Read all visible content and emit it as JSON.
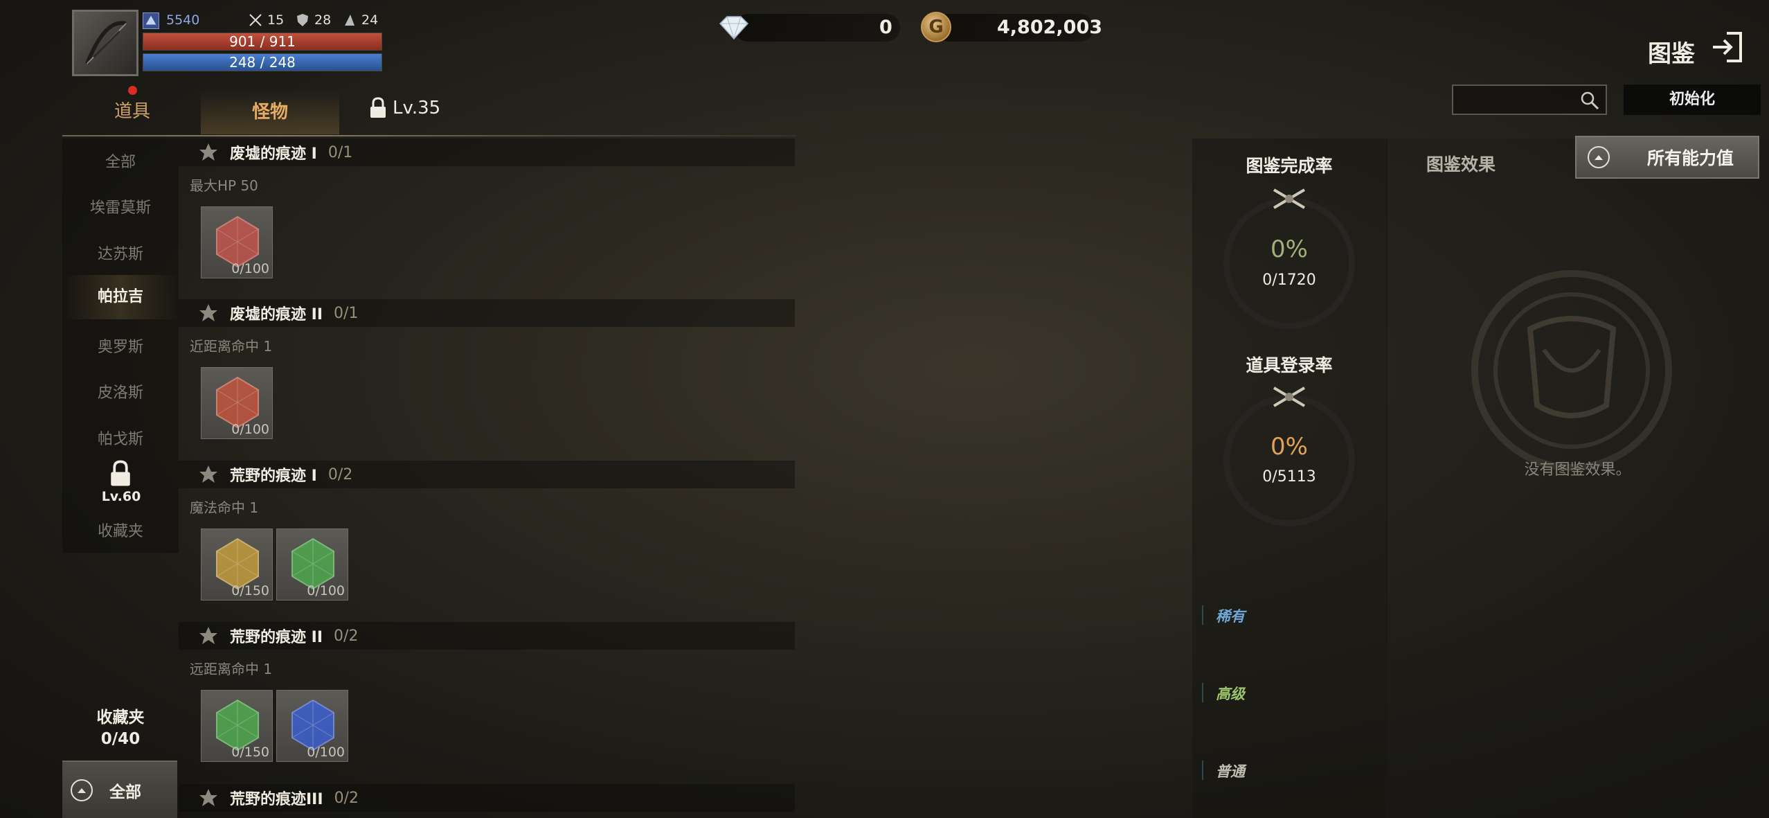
{
  "player": {
    "power": "5540",
    "stat_attack": "15",
    "stat_defense": "28",
    "stat_magic": "24",
    "hp": "901 / 911",
    "mp": "248 / 248"
  },
  "currency": {
    "diamond": "0",
    "gold": "4,802,003",
    "gold_symbol": "G"
  },
  "header": {
    "title": "图鉴",
    "search_placeholder": "",
    "reset_label": "初始化"
  },
  "tabs": {
    "items": "道具",
    "monsters": "怪物",
    "locked_level": "Lv.35"
  },
  "sidebar": {
    "items": [
      "全部",
      "埃雷莫斯",
      "达苏斯",
      "帕拉吉",
      "奥罗斯",
      "皮洛斯",
      "帕戈斯"
    ],
    "active_index": 3,
    "locked_level": "Lv.60",
    "favorites": "收藏夹",
    "favorites_title": "收藏夹",
    "favorites_count": "0/40",
    "all_button": "全部"
  },
  "entries": [
    {
      "name": "废墟的痕迹 I",
      "count": "0/1",
      "effect": "最大HP 50",
      "cards": [
        {
          "color": "#c8554e",
          "count": "0/100"
        }
      ]
    },
    {
      "name": "废墟的痕迹 II",
      "count": "0/1",
      "effect": "近距离命中 1",
      "cards": [
        {
          "color": "#c8553e",
          "count": "0/100"
        }
      ]
    },
    {
      "name": "荒野的痕迹 I",
      "count": "0/2",
      "effect": "魔法命中 1",
      "cards": [
        {
          "color": "#c9a03b",
          "count": "0/150"
        },
        {
          "color": "#4fae4f",
          "count": "0/100"
        }
      ]
    },
    {
      "name": "荒野的痕迹 II",
      "count": "0/2",
      "effect": "远距离命中 1",
      "cards": [
        {
          "color": "#4fae4f",
          "count": "0/150"
        },
        {
          "color": "#3a5fd6",
          "count": "0/100"
        }
      ]
    },
    {
      "name": "荒野的痕迹III",
      "count": "0/2",
      "effect": "",
      "cards": []
    }
  ],
  "stats": {
    "completion_title": "图鉴完成率",
    "completion_pct": "0%",
    "completion_count": "0/1720",
    "completion_color": "#a3b07a",
    "register_title": "道具登录率",
    "register_pct": "0%",
    "register_count": "0/5113",
    "register_color": "#e3a05a"
  },
  "grades": [
    {
      "label": "稀有",
      "color": "#6fa7d8"
    },
    {
      "label": "高级",
      "color": "#9cc46a"
    },
    {
      "label": "普通",
      "color": "#c2beb2"
    }
  ],
  "effects": {
    "title": "图鉴效果",
    "all_stats_button": "所有能力值",
    "empty_text": "没有图鉴效果。"
  },
  "icons": {
    "exit": "exit-icon",
    "search": "search-icon",
    "lock": "lock-icon",
    "star": "star-icon",
    "diamond": "diamond-icon",
    "gold": "gold-coin-icon"
  }
}
